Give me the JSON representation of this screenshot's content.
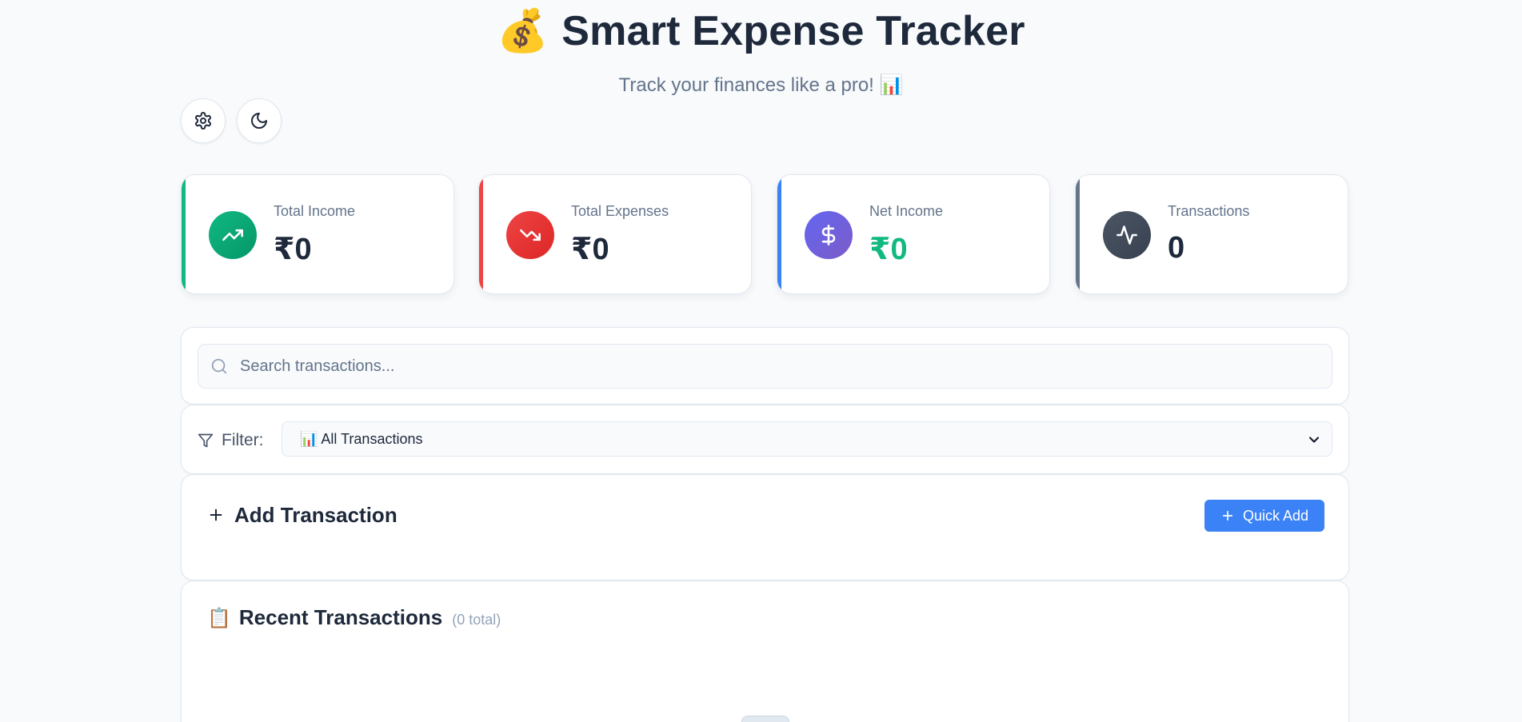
{
  "header": {
    "emoji": "💰",
    "title": "Smart Expense Tracker",
    "subtitle": "Track your finances like a pro! 📊"
  },
  "toolbar": {
    "settings_icon": "gear-icon",
    "theme_icon": "moon-icon"
  },
  "stats": [
    {
      "label": "Total Income",
      "value": "₹0",
      "icon": "trending-up-icon",
      "accent": "#10b981",
      "value_color": "#1e293b"
    },
    {
      "label": "Total Expenses",
      "value": "₹0",
      "icon": "trending-down-icon",
      "accent": "#ef4444",
      "value_color": "#1e293b"
    },
    {
      "label": "Net Income",
      "value": "₹0",
      "icon": "dollar-icon",
      "accent": "#3b82f6",
      "value_color": "#10b981"
    },
    {
      "label": "Transactions",
      "value": "0",
      "icon": "activity-icon",
      "accent": "#64748b",
      "value_color": "#1e293b"
    }
  ],
  "search": {
    "placeholder": "Search transactions..."
  },
  "filter": {
    "label": "Filter:",
    "selected": "📊 All Transactions"
  },
  "add_transaction": {
    "title": "Add Transaction",
    "quick_add_label": "Quick Add"
  },
  "recent": {
    "emoji": "📋",
    "title": "Recent Transactions",
    "count_text": "(0 total)"
  },
  "colors": {
    "primary": "#3b82f6",
    "income_green": "#10b981",
    "expense_red": "#ef4444",
    "net_purple": "#6d5bd0",
    "neutral_gray": "#4b5563"
  }
}
